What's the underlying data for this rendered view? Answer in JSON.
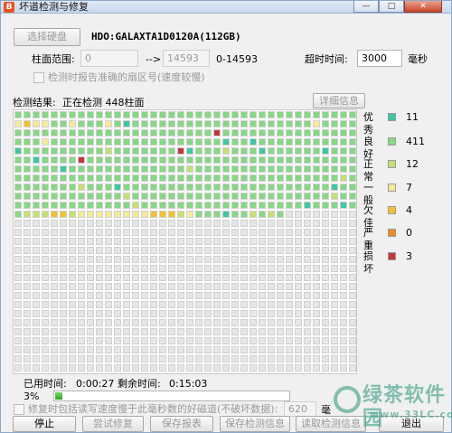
{
  "window": {
    "title": "坏道检测与修复",
    "app_icon": "B",
    "buttons": {
      "minimize": "—",
      "maximize": "□",
      "close": "✕"
    }
  },
  "top": {
    "select_disk_button": "选择硬盘",
    "disk_name": "HDO:GALAXTA1D0120A(112GB)",
    "cylinder_range_label": "柱面范围:",
    "cylinder_start": "0",
    "arrow": "-->",
    "cylinder_end": "14593",
    "cylinder_total": "0-14593",
    "timeout_label": "超时时间:",
    "timeout_value": "3000",
    "timeout_unit": "毫秒",
    "report_sector_checkbox_label": "检测时报告准确的扇区号(速度较慢)"
  },
  "result": {
    "label": "检测结果:",
    "status": "正在检测 448柱面",
    "details_button": "详细信息"
  },
  "legend": [
    {
      "label": "优秀",
      "count": "11",
      "color": "#3fc7a2"
    },
    {
      "label": "良好",
      "count": "411",
      "color": "#86d884"
    },
    {
      "label": "正常",
      "count": "12",
      "color": "#c6df73"
    },
    {
      "label": "一般",
      "count": "7",
      "color": "#f5ea9a"
    },
    {
      "label": "欠佳",
      "count": "4",
      "color": "#f3c12e"
    },
    {
      "label": "严重",
      "count": "0",
      "color": "#f18b24"
    },
    {
      "label": "损坏",
      "count": "3",
      "color": "#c3363a"
    }
  ],
  "grid": {
    "columns": 38,
    "scanned_cells": 448,
    "total_cells": 1102,
    "colors": {
      "excellent": "#3fc7a2",
      "good": "#86d884",
      "normal": "#c6df73",
      "fair": "#f5ea9a",
      "poor": "#f3c12e",
      "severe": "#f18b24",
      "damaged": "#c3363a",
      "unscanned": "#e6e6e6"
    }
  },
  "status": {
    "elapsed_label": "已用时间:",
    "elapsed_value": "0:00:27",
    "remaining_label": "剩余时间:",
    "remaining_value": "0:15:03",
    "progress_percent": "3%",
    "progress_fraction": 0.031
  },
  "repair": {
    "checkbox_label": "修复时包括读写速度慢于此毫秒数的好磁道(不破坏数据):",
    "threshold_value": "620",
    "threshold_unit": "毫"
  },
  "buttons": {
    "stop": "停止",
    "try_repair": "尝试修复",
    "save_report": "保存报表",
    "save_state": "保存检测信息",
    "load_state": "读取检测信息",
    "exit": "退出"
  },
  "watermark": {
    "main": "绿茶软件园",
    "sub": "www.33LC.com"
  }
}
